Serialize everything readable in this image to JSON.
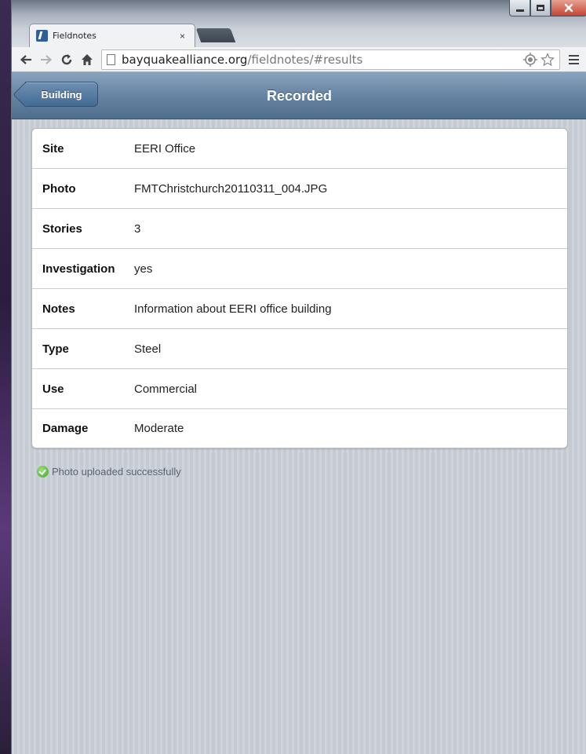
{
  "browser": {
    "tab_title": "Fieldnotes",
    "tab_close": "×",
    "url_host": "bayquakealliance.org",
    "url_path": "/fieldnotes/#results"
  },
  "header": {
    "back_label": "Building",
    "title": "Recorded"
  },
  "records": [
    {
      "label": "Site",
      "value": "EERI Office"
    },
    {
      "label": "Photo",
      "value": "FMTChristchurch20110311_004.JPG"
    },
    {
      "label": "Stories",
      "value": "3"
    },
    {
      "label": "Investigation",
      "value": "yes"
    },
    {
      "label": "Notes",
      "value": "Information about EERI office building"
    },
    {
      "label": "Type",
      "value": "Steel"
    },
    {
      "label": "Use",
      "value": "Commercial"
    },
    {
      "label": "Damage",
      "value": "Moderate"
    }
  ],
  "status": {
    "message": "Photo uploaded successfully",
    "icon": "check-circle-icon",
    "color": "#3ea52a"
  },
  "colors": {
    "header": "#6a87a5",
    "background": "#c5cbd3"
  }
}
